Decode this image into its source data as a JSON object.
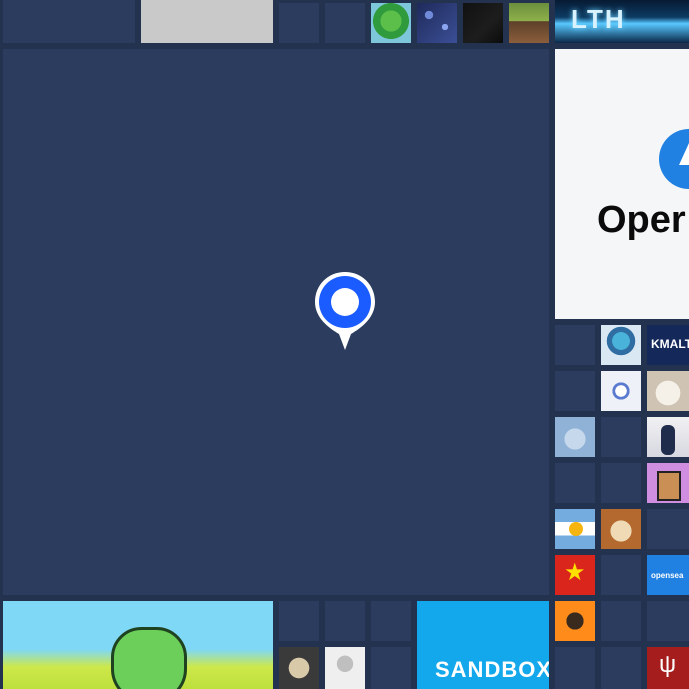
{
  "map": {
    "pin_icon": "location-pin-icon",
    "colors": {
      "background": "#22324f",
      "tile": "#2b3c5f",
      "pin_blue": "#1a5cff"
    }
  },
  "tiles": {
    "opensea_logo_text": "Oper",
    "sandbox_text": "SANDBOX",
    "kmalt_text": "KMALT",
    "opensea_small_text": "opensea",
    "neon_text": "LTH"
  }
}
